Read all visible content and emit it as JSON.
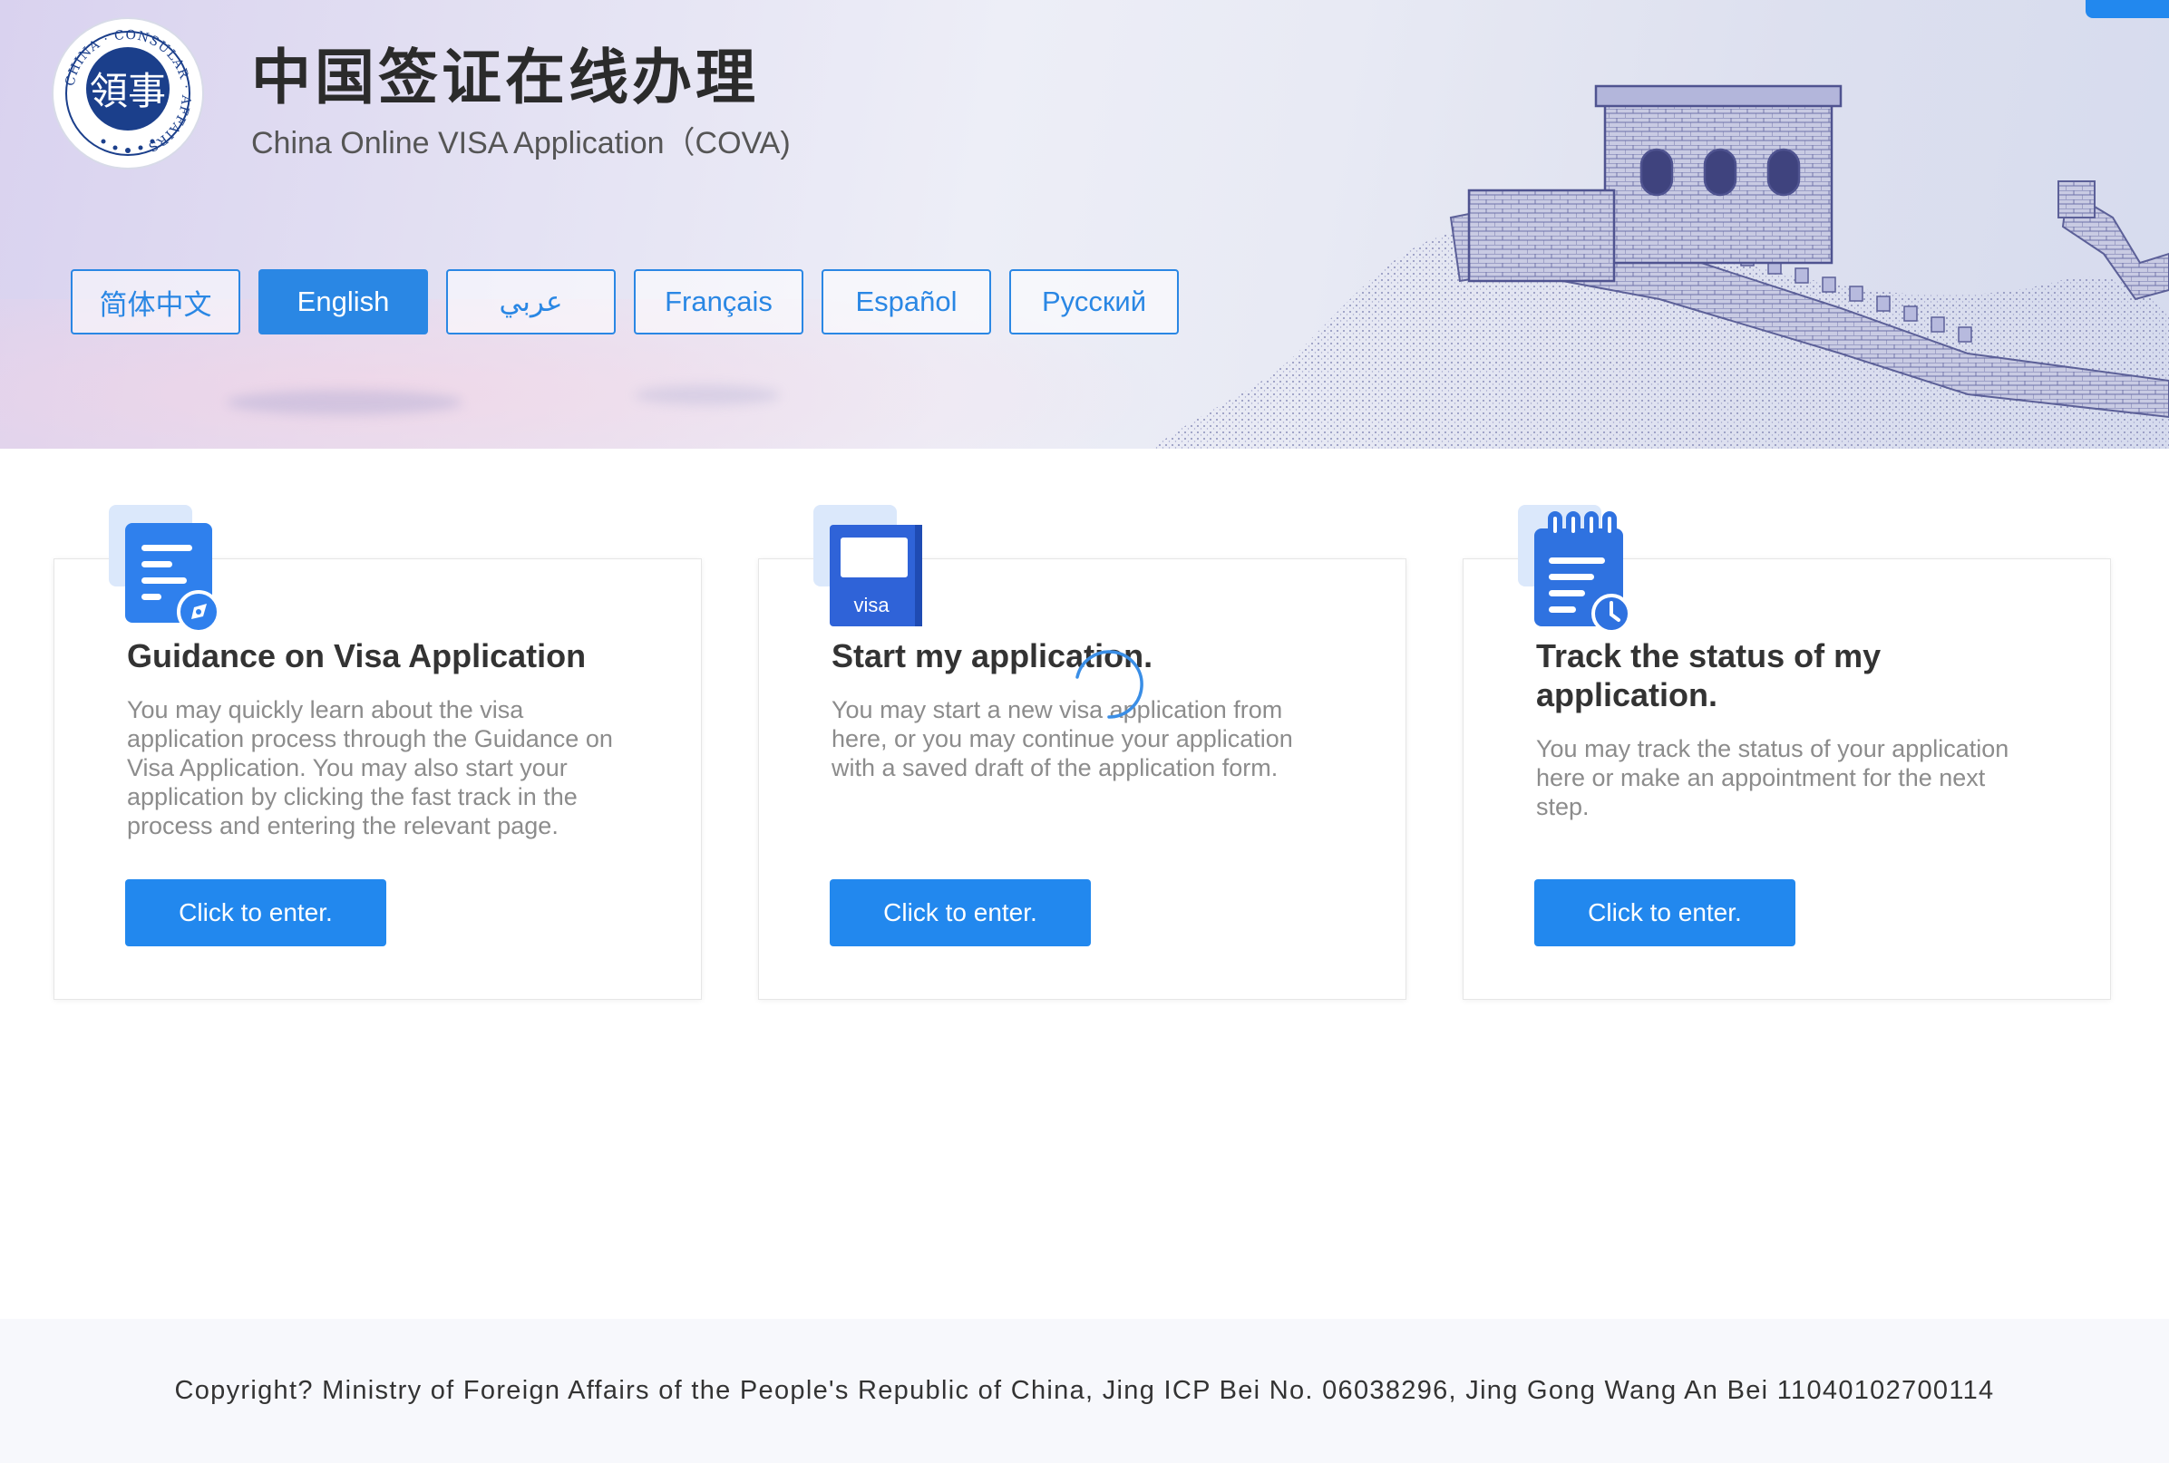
{
  "header": {
    "title_cn": "中国签证在线办理",
    "title_en": "China Online VISA Application（COVA)",
    "logo": {
      "ring_text": "CHINA · CONSULAR · AFFAIRS",
      "center_text": "領事",
      "icon": "consular-seal-icon"
    },
    "languages": [
      {
        "label": "简体中文",
        "active": false
      },
      {
        "label": "English",
        "active": true
      },
      {
        "label": "عربي",
        "active": false
      },
      {
        "label": "Français",
        "active": false
      },
      {
        "label": "Español",
        "active": false
      },
      {
        "label": "Русский",
        "active": false
      }
    ]
  },
  "cards": [
    {
      "icon": "guidance-document-icon",
      "title": "Guidance on Visa Application",
      "description": "You may quickly learn about the visa application process through the Guidance on Visa Application. You may also start your application by clicking the fast track in the process and entering the relevant page.",
      "button": "Click to enter."
    },
    {
      "icon": "visa-passport-icon",
      "icon_label": "visa",
      "title": "Start my application.",
      "description": "You may start a new visa application from here, or you may continue your application with a saved draft of the application form.",
      "button": "Click to enter."
    },
    {
      "icon": "track-status-clipboard-icon",
      "title": "Track the status of my application.",
      "description": "You may track the status of your application here or make an appointment for the next step.",
      "button": "Click to enter."
    }
  ],
  "footer": {
    "copyright": "Copyright? Ministry of Foreign Affairs of the People's Republic of China, Jing ICP Bei No. 06038296, Jing Gong Wang An Bei 11040102700114"
  },
  "colors": {
    "primary": "#2288ee",
    "title": "#333333",
    "description": "#8c8c8c",
    "footer_bg": "#f7f8fc"
  }
}
